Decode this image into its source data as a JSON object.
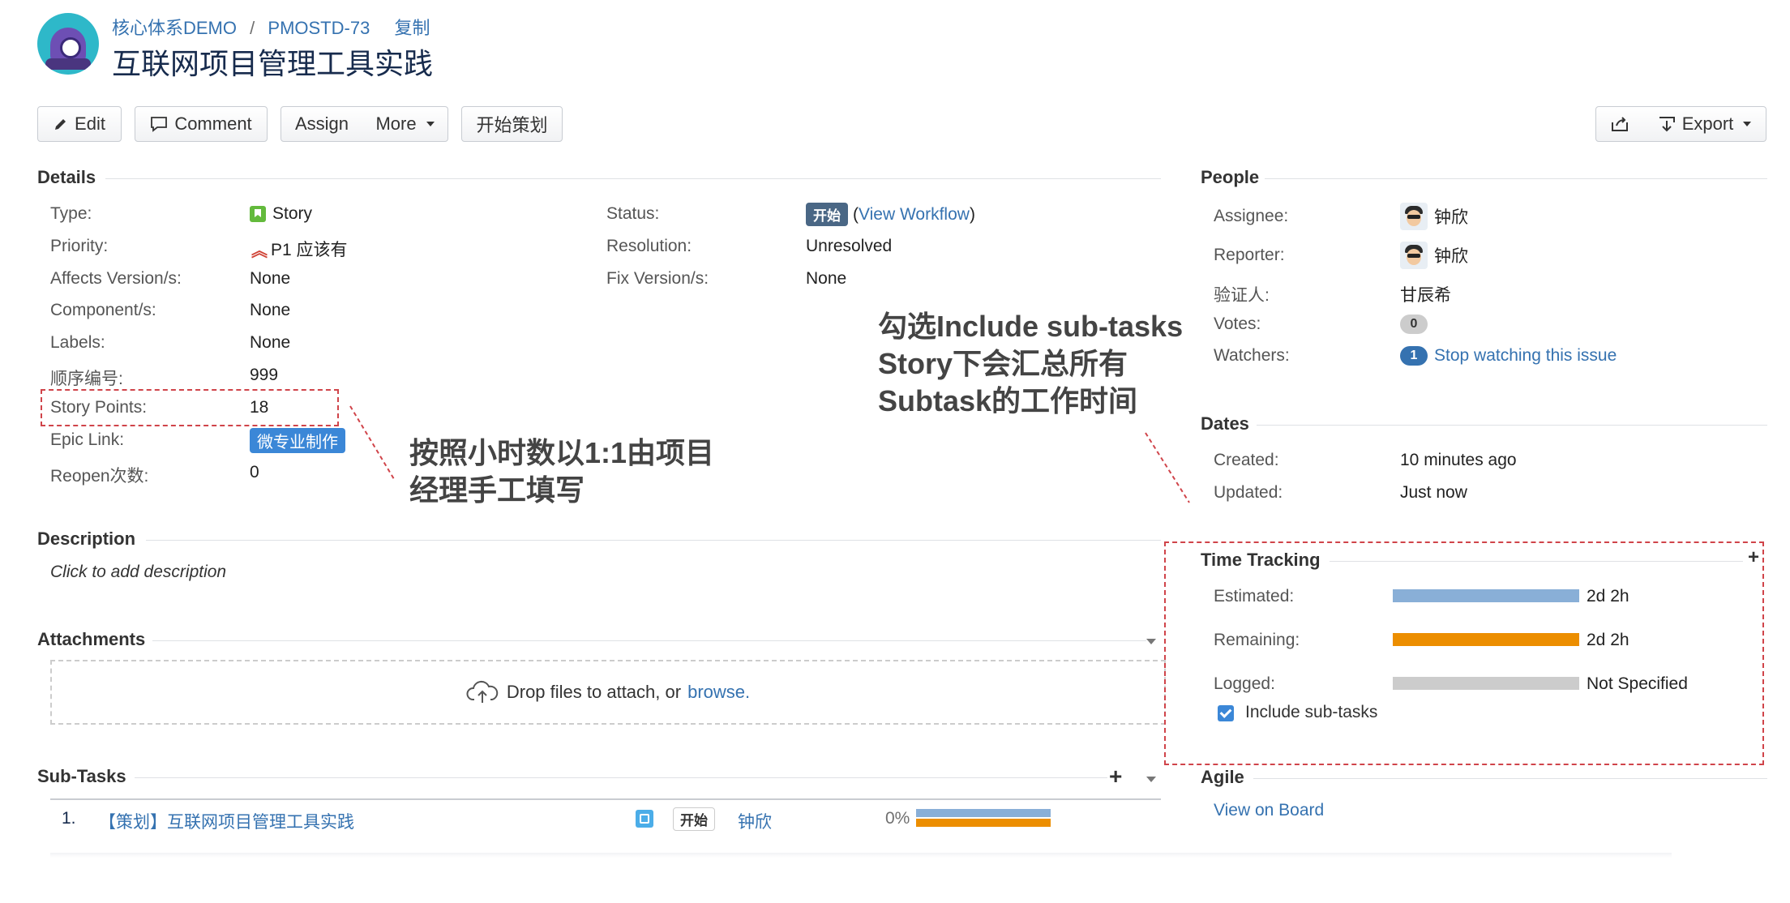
{
  "header": {
    "project": "核心体系DEMO",
    "separator": "/",
    "issue_key": "PMOSTD-73",
    "copy": "复制",
    "title": "互联网项目管理工具实践"
  },
  "toolbar": {
    "edit": "Edit",
    "comment": "Comment",
    "assign": "Assign",
    "more": "More",
    "start_plan": "开始策划",
    "export": "Export"
  },
  "details": {
    "heading": "Details",
    "type_label": "Type:",
    "type_value": "Story",
    "priority_label": "Priority:",
    "priority_value": "P1 应该有",
    "affects_label": "Affects Version/s:",
    "affects_value": "None",
    "component_label": "Component/s:",
    "component_value": "None",
    "labels_label": "Labels:",
    "labels_value": "None",
    "seq_label": "顺序编号:",
    "seq_value": "999",
    "sp_label": "Story Points:",
    "sp_value": "18",
    "epic_label": "Epic Link:",
    "epic_value": "微专业制作",
    "reopen_label": "Reopen次数:",
    "reopen_value": "0",
    "status_label": "Status:",
    "status_value": "开始",
    "view_workflow": "View Workflow",
    "resolution_label": "Resolution:",
    "resolution_value": "Unresolved",
    "fix_label": "Fix Version/s:",
    "fix_value": "None"
  },
  "people": {
    "heading": "People",
    "assignee_label": "Assignee:",
    "assignee": "钟欣",
    "reporter_label": "Reporter:",
    "reporter": "钟欣",
    "verifier_label": "验证人:",
    "verifier": "甘辰希",
    "votes_label": "Votes:",
    "votes": "0",
    "watchers_label": "Watchers:",
    "watchers": "1",
    "stop_watching": "Stop watching this issue"
  },
  "dates": {
    "heading": "Dates",
    "created_label": "Created:",
    "created": "10 minutes ago",
    "updated_label": "Updated:",
    "updated": "Just now"
  },
  "time_tracking": {
    "heading": "Time Tracking",
    "estimated_label": "Estimated:",
    "estimated": "2d 2h",
    "remaining_label": "Remaining:",
    "remaining": "2d 2h",
    "logged_label": "Logged:",
    "logged": "Not Specified",
    "include_subtasks": "Include sub-tasks",
    "estimated_fill": 1.0,
    "remaining_fill": 1.0,
    "logged_fill": 0.0,
    "colors": {
      "estimated": "#89afd7",
      "remaining": "#ec8e00",
      "logged": "#cccccc"
    }
  },
  "description": {
    "heading": "Description",
    "placeholder": "Click to add description"
  },
  "attachments": {
    "heading": "Attachments",
    "drop_text": "Drop files to attach, or",
    "browse": "browse."
  },
  "subtasks": {
    "heading": "Sub-Tasks",
    "items": [
      {
        "index": "1.",
        "title": "【策划】互联网项目管理工具实践",
        "status": "开始",
        "assignee": "钟欣",
        "progress": "0%"
      }
    ]
  },
  "agile": {
    "heading": "Agile",
    "view_on_board": "View on Board"
  },
  "annotations": {
    "left_line1": "按照小时数以1:1由项目",
    "left_line2": "经理手工填写",
    "right_line1": "勾选Include sub-tasks",
    "right_line2": "Story下会汇总所有",
    "right_line3": "Subtask的工作时间"
  }
}
